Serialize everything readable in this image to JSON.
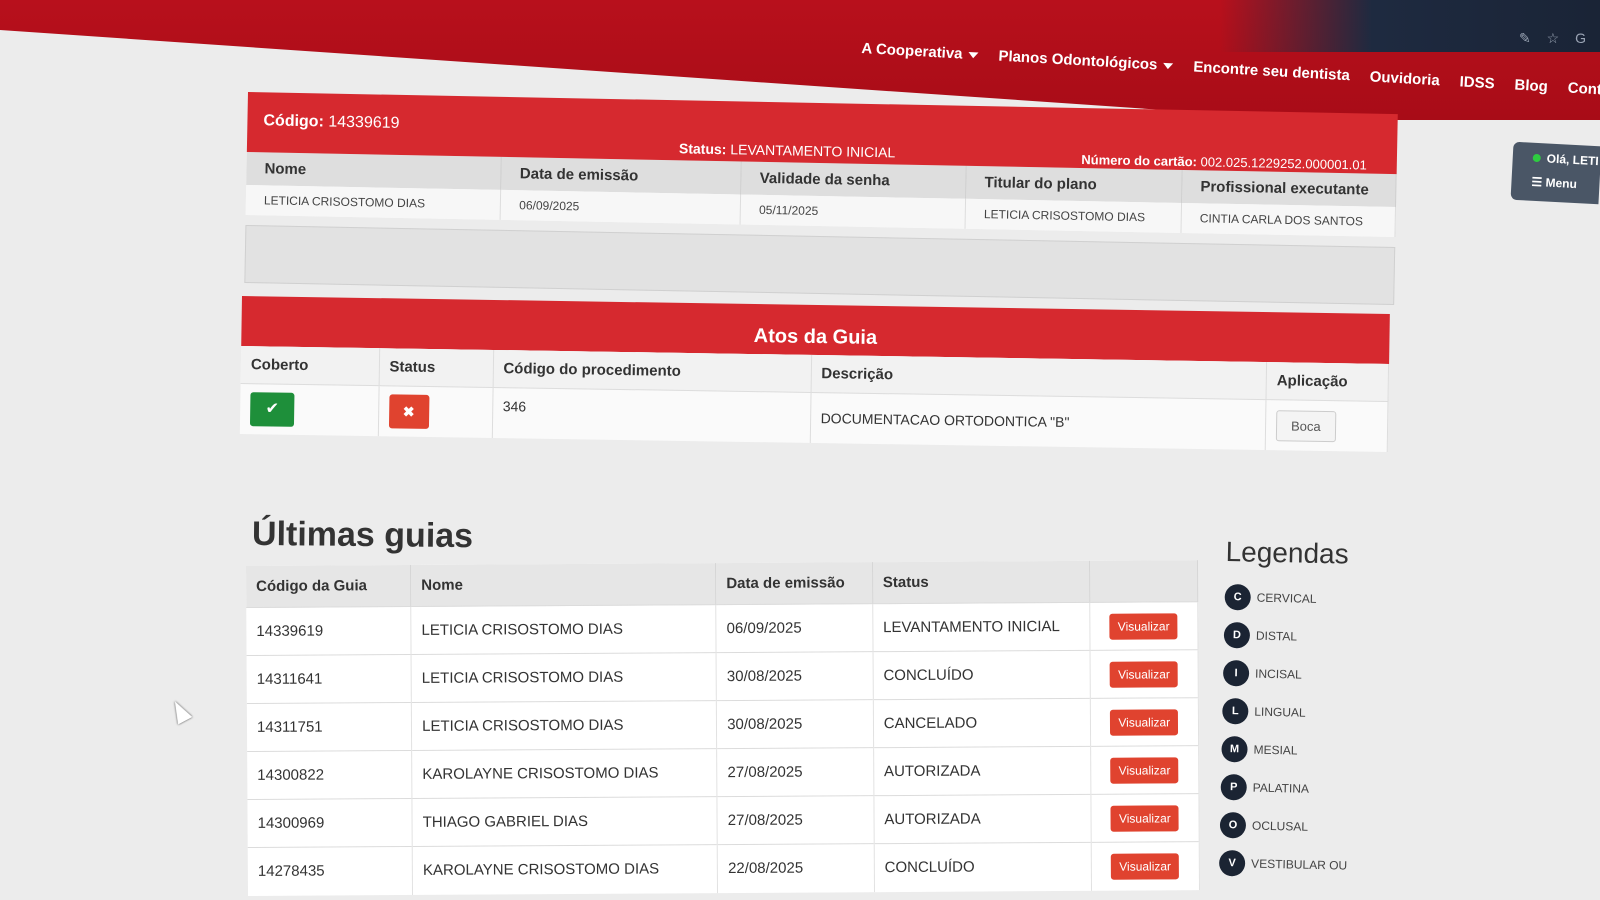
{
  "nav": {
    "items": [
      {
        "label": "A Cooperativa",
        "has_dropdown": true
      },
      {
        "label": "Planos Odontológicos",
        "has_dropdown": true
      },
      {
        "label": "Encontre seu dentista",
        "has_dropdown": false
      },
      {
        "label": "Ouvidoria",
        "has_dropdown": false
      },
      {
        "label": "IDSS",
        "has_dropdown": false
      },
      {
        "label": "Blog",
        "has_dropdown": false
      },
      {
        "label": "Cont",
        "has_dropdown": false
      }
    ]
  },
  "user_panel": {
    "greeting": "Olá, LETI",
    "menu": "Menu"
  },
  "guia": {
    "codigo_label": "Código:",
    "codigo_value": "14339619",
    "status_label": "Status:",
    "status_value": "LEVANTAMENTO INICIAL",
    "cartao_label": "Número do cartão:",
    "cartao_value": "002.025.1229252.000001.01",
    "headers": [
      "Nome",
      "Data de emissão",
      "Validade da senha",
      "Titular do plano",
      "Profissional executante"
    ],
    "values": [
      "LETICIA CRISOSTOMO DIAS",
      "06/09/2025",
      "05/11/2025",
      "LETICIA CRISOSTOMO DIAS",
      "CINTIA CARLA DOS SANTOS"
    ]
  },
  "atos": {
    "title": "Atos da Guia",
    "headers": [
      "Coberto",
      "Status",
      "Código do procedimento",
      "Descrição",
      "Aplicação"
    ],
    "row": {
      "coberto_icon": "check-icon",
      "status_icon": "x-icon",
      "codigo": "346",
      "descricao": "DOCUMENTACAO ORTODONTICA \"B\"",
      "aplicacao": "Boca"
    }
  },
  "ultimas": {
    "title": "Últimas guias",
    "headers": [
      "Código da Guia",
      "Nome",
      "Data de emissão",
      "Status",
      ""
    ],
    "button_label": "Visualizar",
    "rows": [
      {
        "codigo": "14339619",
        "nome": "LETICIA CRISOSTOMO DIAS",
        "data": "06/09/2025",
        "status": "LEVANTAMENTO INICIAL"
      },
      {
        "codigo": "14311641",
        "nome": "LETICIA CRISOSTOMO DIAS",
        "data": "30/08/2025",
        "status": "CONCLUÍDO"
      },
      {
        "codigo": "14311751",
        "nome": "LETICIA CRISOSTOMO DIAS",
        "data": "30/08/2025",
        "status": "CANCELADO"
      },
      {
        "codigo": "14300822",
        "nome": "KAROLAYNE CRISOSTOMO DIAS",
        "data": "27/08/2025",
        "status": "AUTORIZADA"
      },
      {
        "codigo": "14300969",
        "nome": "THIAGO GABRIEL DIAS",
        "data": "27/08/2025",
        "status": "AUTORIZADA"
      },
      {
        "codigo": "14278435",
        "nome": "KAROLAYNE CRISOSTOMO DIAS",
        "data": "22/08/2025",
        "status": "CONCLUÍDO"
      }
    ]
  },
  "legendas": {
    "title": "Legendas",
    "items": [
      {
        "letter": "C",
        "label": "CERVICAL"
      },
      {
        "letter": "D",
        "label": "DISTAL"
      },
      {
        "letter": "I",
        "label": "INCISAL"
      },
      {
        "letter": "L",
        "label": "LINGUAL"
      },
      {
        "letter": "M",
        "label": "MESIAL"
      },
      {
        "letter": "P",
        "label": "PALATINA"
      },
      {
        "letter": "O",
        "label": "OCLUSAL"
      },
      {
        "letter": "V",
        "label": "VESTIBULAR OU"
      }
    ]
  },
  "colors": {
    "brand_red": "#d6292f",
    "success_green": "#1e8f3a",
    "danger": "#e0432f",
    "dark": "#1b2433"
  }
}
